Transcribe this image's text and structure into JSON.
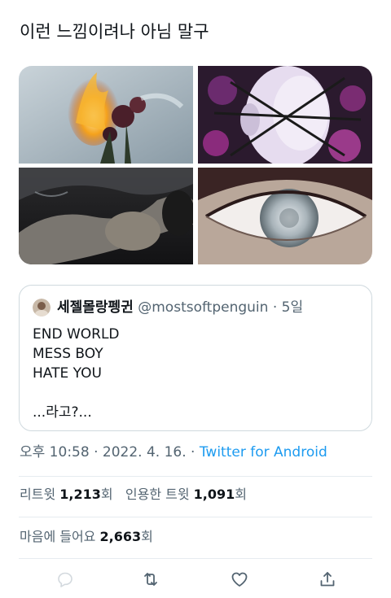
{
  "tweet": {
    "text": "이런 느낌이려나 아님 말구"
  },
  "media": [
    {
      "name": "burning-flowers-image"
    },
    {
      "name": "mannequin-barbed-wire-image"
    },
    {
      "name": "figure-underwater-image"
    },
    {
      "name": "glitter-eye-image"
    }
  ],
  "quote": {
    "display_name": "세젤몰랑펭귄",
    "handle": "@mostsoftpenguin",
    "separator": "·",
    "time": "5일",
    "lines": [
      "END WORLD",
      "MESS BOY",
      "HATE YOU",
      "",
      "...라고?..."
    ]
  },
  "meta": {
    "time": "오후 10:58",
    "sep1": " · ",
    "date": "2022. 4. 16.",
    "sep2": " · ",
    "source": "Twitter for Android"
  },
  "stats": {
    "retweets_label": "리트윗",
    "retweets_count": "1,213",
    "retweets_unit": "회",
    "quotes_label": "인용한 트윗",
    "quotes_count": "1,091",
    "quotes_unit": "회",
    "likes_label": "마음에 들어요",
    "likes_count": "2,663",
    "likes_unit": "회"
  },
  "actions": {
    "reply_icon": "reply-icon",
    "retweet_icon": "retweet-icon",
    "like_icon": "heart-icon",
    "share_icon": "share-icon"
  },
  "colors": {
    "accent": "#1d9bf0",
    "text": "#0f1419",
    "muted": "#536471",
    "border": "#cfd9de"
  }
}
